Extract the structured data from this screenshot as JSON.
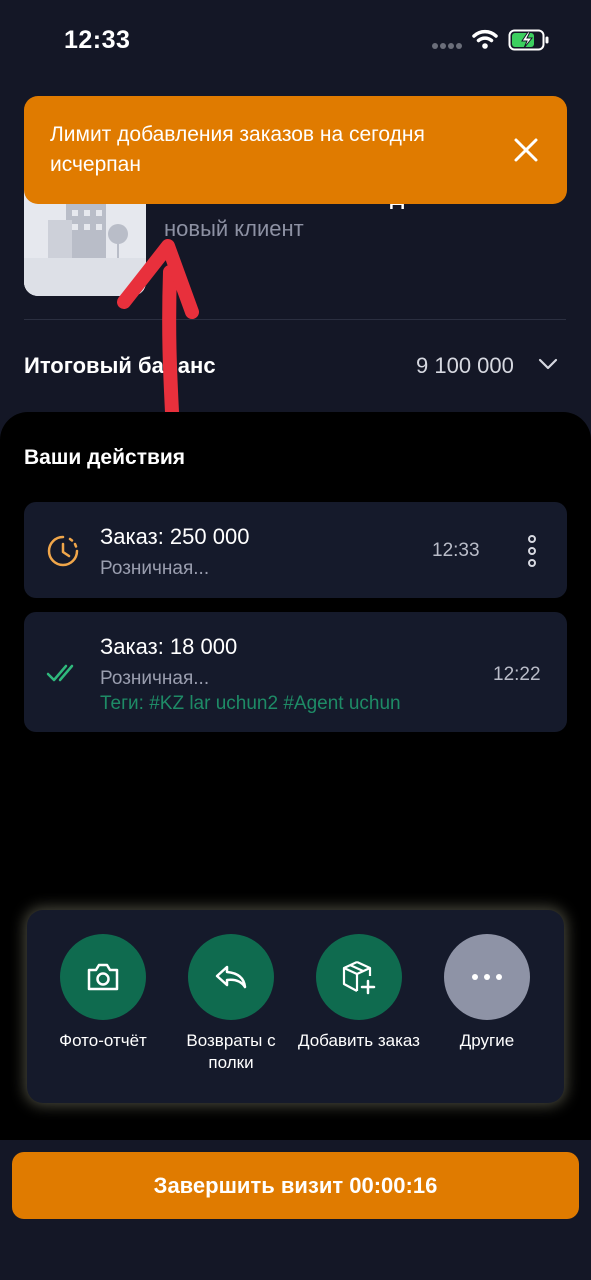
{
  "status_bar": {
    "time": "12:33"
  },
  "client": {
    "title": "Д",
    "subtitle": "новый клиент"
  },
  "balance": {
    "label": "Итоговый баланс",
    "value": "9 100 000"
  },
  "toast": {
    "message": "Лимит добавления заказов на сегодня исчерпан",
    "close_icon": "close-icon"
  },
  "actions": {
    "title": "Ваши действия",
    "orders": [
      {
        "title": "Заказ: 250 000",
        "subtitle": "Розничная...",
        "time": "12:33",
        "status_icon": "clock-icon",
        "tags": ""
      },
      {
        "title": "Заказ: 18 000",
        "subtitle": "Розничная...",
        "time": "12:22",
        "status_icon": "double-check-icon",
        "tags": "Теги: #KZ lar uchun2 #Agent uchun"
      }
    ]
  },
  "quick_actions": [
    {
      "label": "Фото-отчёт",
      "icon": "camera-icon",
      "color": "#0f6b4f"
    },
    {
      "label": "Возвраты с полки",
      "icon": "return-arrow-icon",
      "color": "#0f6b4f"
    },
    {
      "label": "Добавить заказ",
      "icon": "add-box-icon",
      "color": "#0f6b4f"
    },
    {
      "label": "Другие",
      "icon": "more-icon",
      "color": "#8e93a6"
    }
  ],
  "finish_button": {
    "label": "Завершить визит 00:00:16"
  },
  "colors": {
    "accent": "#e07b00",
    "success": "#1e8b66",
    "background_dark": "#141726",
    "card": "#151a2b"
  }
}
